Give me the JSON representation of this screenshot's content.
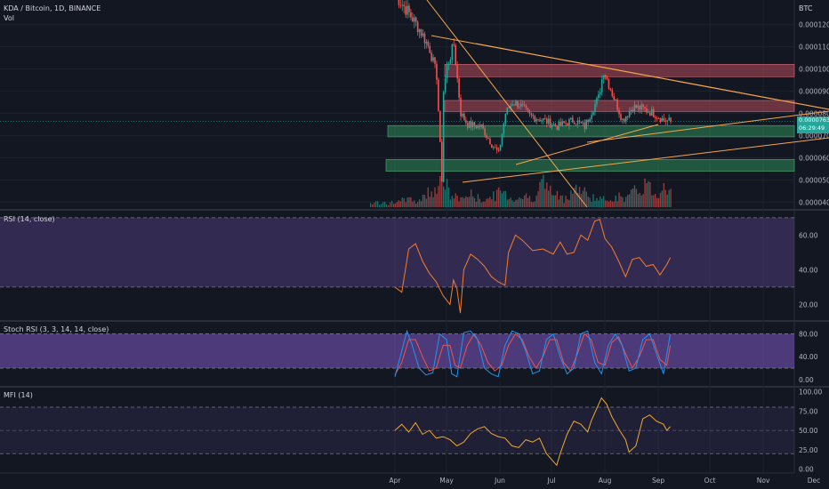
{
  "header": {
    "symbol": "KDA / Bitcoin, 1D, BINANCE",
    "vol_label": "Vol",
    "currency": "BTC"
  },
  "panels": {
    "rsi_label": "RSI (14, close)",
    "stoch_label": "Stoch RSI (3, 3, 14, 14, close)",
    "mfi_label": "MFI (14)"
  },
  "price_tag": {
    "value": "0.0000763",
    "countdown": "06:29:49"
  },
  "colors": {
    "up": "#26a69a",
    "down": "#ef5350",
    "trendline": "#f7a64a",
    "rsi": "#f57c2c",
    "stoch_k": "#2196f3",
    "stoch_d": "#ef5350",
    "mfi": "#f0a830",
    "band": "#7e57c2",
    "res_zone": "#b74a5b",
    "sup_zone": "#2e8b57"
  },
  "chart_data": [
    {
      "type": "candlestick",
      "title": "KDA / Bitcoin, 1D, BINANCE",
      "ylabel": "BTC",
      "y_ticks": [
        4e-05,
        5e-05,
        6e-05,
        7e-05,
        8e-05,
        9e-05,
        0.0001,
        0.00011,
        0.00012
      ],
      "y_tick_labels": [
        "0.0000400",
        "0.0000500",
        "0.0000600",
        "0.0000700",
        "0.0000800",
        "0.0000900",
        "0.0001000",
        "0.0001100",
        "0.0001200"
      ],
      "ylim": [
        3.77e-05,
        0.0001311
      ],
      "x_tick_labels": [
        "Apr",
        "May",
        "Jun",
        "Jul",
        "Aug",
        "Sep",
        "Oct",
        "Nov",
        "Dec"
      ],
      "zones": [
        {
          "kind": "resistance",
          "from": 9.65e-05,
          "to": 0.0001021
        },
        {
          "kind": "resistance",
          "from": 8.08e-05,
          "to": 8.58e-05
        },
        {
          "kind": "support",
          "from": 6.94e-05,
          "to": 7.45e-05
        },
        {
          "kind": "support",
          "from": 5.39e-05,
          "to": 5.92e-05
        }
      ],
      "anchors": [
        [
          0,
          0.0001335
        ],
        [
          8,
          0.000125
        ],
        [
          14,
          0.000118
        ],
        [
          20,
          0.000109
        ],
        [
          24,
          9.7e-05
        ],
        [
          27,
          5e-05
        ],
        [
          28,
          9e-05
        ],
        [
          30,
          0.000101
        ],
        [
          34,
          0.000111
        ],
        [
          38,
          8e-05
        ],
        [
          42,
          7.5e-05
        ],
        [
          50,
          7.4e-05
        ],
        [
          56,
          6.6e-05
        ],
        [
          60,
          6.2e-05
        ],
        [
          64,
          8e-05
        ],
        [
          68,
          8.5e-05
        ],
        [
          72,
          8.4e-05
        ],
        [
          78,
          7.9e-05
        ],
        [
          86,
          7.7e-05
        ],
        [
          94,
          7.4e-05
        ],
        [
          100,
          7.6e-05
        ],
        [
          104,
          7.7e-05
        ],
        [
          110,
          7.4e-05
        ],
        [
          114,
          8.1e-05
        ],
        [
          118,
          8.7e-05
        ],
        [
          121,
          9.95e-05
        ],
        [
          126,
          8.9e-05
        ],
        [
          132,
          7.7e-05
        ],
        [
          138,
          8.3e-05
        ],
        [
          144,
          8.2e-05
        ],
        [
          150,
          8e-05
        ],
        [
          156,
          7.7e-05
        ],
        [
          160,
          7.63e-05
        ]
      ],
      "last_price": 7.63e-05,
      "volume": [
        [
          0,
          3
        ],
        [
          6,
          10
        ],
        [
          12,
          6
        ],
        [
          18,
          14
        ],
        [
          24,
          25
        ],
        [
          28,
          32
        ],
        [
          32,
          12
        ],
        [
          38,
          10
        ],
        [
          44,
          14
        ],
        [
          50,
          8
        ],
        [
          56,
          11
        ],
        [
          62,
          18
        ],
        [
          68,
          9
        ],
        [
          74,
          12
        ],
        [
          80,
          10
        ],
        [
          86,
          28
        ],
        [
          92,
          14
        ],
        [
          98,
          9
        ],
        [
          104,
          22
        ],
        [
          110,
          16
        ],
        [
          116,
          10
        ],
        [
          122,
          8
        ],
        [
          128,
          12
        ],
        [
          134,
          10
        ],
        [
          140,
          18
        ],
        [
          146,
          26
        ],
        [
          152,
          12
        ],
        [
          156,
          30
        ],
        [
          160,
          18
        ]
      ]
    },
    {
      "type": "line",
      "title": "RSI (14, close)",
      "y_ticks": [
        20,
        40,
        60
      ],
      "y_tick_labels": [
        "20.00",
        "40.00",
        "60.00"
      ],
      "bands": [
        30,
        70
      ],
      "ylim": [
        12,
        73
      ],
      "values": [
        [
          0,
          30
        ],
        [
          4,
          27
        ],
        [
          8,
          52
        ],
        [
          12,
          55
        ],
        [
          16,
          45
        ],
        [
          20,
          38
        ],
        [
          24,
          33
        ],
        [
          28,
          25
        ],
        [
          32,
          20
        ],
        [
          34,
          34
        ],
        [
          36,
          29
        ],
        [
          38,
          15
        ],
        [
          40,
          40
        ],
        [
          44,
          49
        ],
        [
          48,
          46
        ],
        [
          52,
          42
        ],
        [
          56,
          36
        ],
        [
          60,
          33
        ],
        [
          64,
          31
        ],
        [
          66,
          50
        ],
        [
          70,
          60
        ],
        [
          74,
          57
        ],
        [
          80,
          51
        ],
        [
          86,
          52
        ],
        [
          92,
          49
        ],
        [
          96,
          56
        ],
        [
          100,
          49
        ],
        [
          104,
          50
        ],
        [
          108,
          60
        ],
        [
          112,
          57
        ],
        [
          116,
          68
        ],
        [
          119,
          69
        ],
        [
          122,
          58
        ],
        [
          126,
          53
        ],
        [
          130,
          45
        ],
        [
          134,
          36
        ],
        [
          138,
          46
        ],
        [
          142,
          47
        ],
        [
          146,
          42
        ],
        [
          150,
          43
        ],
        [
          154,
          37
        ],
        [
          158,
          43
        ],
        [
          160,
          47
        ]
      ]
    },
    {
      "type": "line",
      "title": "Stoch RSI (3, 3, 14, 14, close)",
      "y_ticks": [
        0,
        40,
        80
      ],
      "y_tick_labels": [
        "0.00",
        "40.00",
        "80.00"
      ],
      "bands": [
        20,
        80
      ],
      "ylim": [
        -8,
        98
      ],
      "series": [
        {
          "key": "k",
          "values": [
            [
              0,
              5
            ],
            [
              4,
              50
            ],
            [
              7,
              85
            ],
            [
              10,
              60
            ],
            [
              14,
              20
            ],
            [
              18,
              8
            ],
            [
              22,
              12
            ],
            [
              26,
              80
            ],
            [
              30,
              70
            ],
            [
              33,
              10
            ],
            [
              36,
              5
            ],
            [
              40,
              82
            ],
            [
              44,
              85
            ],
            [
              48,
              70
            ],
            [
              52,
              20
            ],
            [
              56,
              10
            ],
            [
              60,
              5
            ],
            [
              64,
              60
            ],
            [
              68,
              85
            ],
            [
              72,
              80
            ],
            [
              76,
              50
            ],
            [
              80,
              10
            ],
            [
              84,
              15
            ],
            [
              88,
              70
            ],
            [
              92,
              80
            ],
            [
              96,
              40
            ],
            [
              100,
              10
            ],
            [
              104,
              20
            ],
            [
              108,
              80
            ],
            [
              112,
              85
            ],
            [
              116,
              30
            ],
            [
              120,
              10
            ],
            [
              124,
              60
            ],
            [
              128,
              80
            ],
            [
              132,
              60
            ],
            [
              136,
              15
            ],
            [
              140,
              20
            ],
            [
              144,
              70
            ],
            [
              148,
              80
            ],
            [
              152,
              45
            ],
            [
              156,
              10
            ],
            [
              160,
              80
            ]
          ]
        },
        {
          "key": "d",
          "values": [
            [
              0,
              8
            ],
            [
              4,
              30
            ],
            [
              8,
              70
            ],
            [
              12,
              70
            ],
            [
              16,
              40
            ],
            [
              20,
              15
            ],
            [
              24,
              20
            ],
            [
              28,
              60
            ],
            [
              32,
              60
            ],
            [
              35,
              25
            ],
            [
              38,
              20
            ],
            [
              42,
              60
            ],
            [
              46,
              80
            ],
            [
              50,
              60
            ],
            [
              54,
              30
            ],
            [
              58,
              15
            ],
            [
              62,
              25
            ],
            [
              66,
              60
            ],
            [
              70,
              80
            ],
            [
              74,
              70
            ],
            [
              78,
              40
            ],
            [
              82,
              20
            ],
            [
              86,
              40
            ],
            [
              90,
              70
            ],
            [
              94,
              70
            ],
            [
              98,
              30
            ],
            [
              102,
              15
            ],
            [
              106,
              45
            ],
            [
              110,
              80
            ],
            [
              114,
              70
            ],
            [
              118,
              30
            ],
            [
              122,
              25
            ],
            [
              126,
              65
            ],
            [
              130,
              75
            ],
            [
              134,
              45
            ],
            [
              138,
              20
            ],
            [
              142,
              40
            ],
            [
              146,
              70
            ],
            [
              150,
              70
            ],
            [
              154,
              35
            ],
            [
              158,
              25
            ],
            [
              160,
              60
            ]
          ]
        }
      ]
    },
    {
      "type": "line",
      "title": "MFI (14)",
      "y_ticks": [
        0,
        25,
        50,
        75,
        100
      ],
      "y_tick_labels": [
        "0.00",
        "25.00",
        "50.00",
        "75.00",
        "100.00"
      ],
      "bands": [
        20,
        80
      ],
      "ylim": [
        -5,
        103
      ],
      "values": [
        [
          0,
          50
        ],
        [
          4,
          58
        ],
        [
          8,
          48
        ],
        [
          12,
          60
        ],
        [
          16,
          45
        ],
        [
          20,
          50
        ],
        [
          24,
          40
        ],
        [
          28,
          42
        ],
        [
          32,
          38
        ],
        [
          36,
          30
        ],
        [
          40,
          35
        ],
        [
          44,
          46
        ],
        [
          48,
          52
        ],
        [
          52,
          55
        ],
        [
          56,
          46
        ],
        [
          60,
          42
        ],
        [
          64,
          40
        ],
        [
          68,
          30
        ],
        [
          72,
          28
        ],
        [
          76,
          38
        ],
        [
          80,
          35
        ],
        [
          84,
          40
        ],
        [
          88,
          20
        ],
        [
          92,
          10
        ],
        [
          94,
          5
        ],
        [
          96,
          20
        ],
        [
          100,
          45
        ],
        [
          104,
          62
        ],
        [
          108,
          58
        ],
        [
          112,
          48
        ],
        [
          114,
          62
        ],
        [
          118,
          82
        ],
        [
          120,
          92
        ],
        [
          123,
          84
        ],
        [
          126,
          68
        ],
        [
          130,
          52
        ],
        [
          134,
          38
        ],
        [
          136,
          22
        ],
        [
          140,
          30
        ],
        [
          144,
          65
        ],
        [
          148,
          70
        ],
        [
          152,
          62
        ],
        [
          156,
          58
        ],
        [
          158,
          50
        ],
        [
          160,
          55
        ]
      ]
    }
  ]
}
